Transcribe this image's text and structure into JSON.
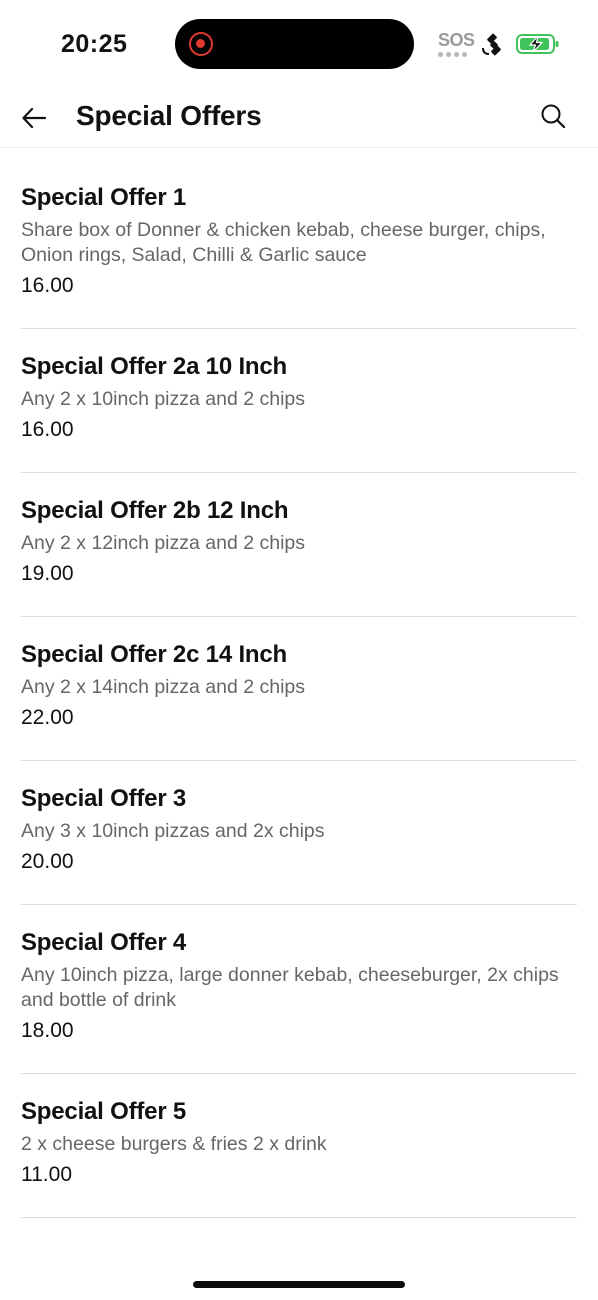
{
  "status_bar": {
    "time": "20:25",
    "sos_label": "SOS",
    "icons": [
      "recording-indicator",
      "satellite-icon",
      "battery-charging-icon"
    ],
    "battery_color": "#3fc35a",
    "recording_color": "#e23a2e"
  },
  "header": {
    "title": "Special Offers",
    "back_icon": "back-arrow-icon",
    "search_icon": "search-icon"
  },
  "offers": [
    {
      "name": "Special Offer 1",
      "description": "Share box of Donner & chicken kebab, cheese burger, chips, Onion rings, Salad, Chilli & Garlic sauce",
      "price": "16.00"
    },
    {
      "name": "Special Offer 2a 10 Inch",
      "description": "Any 2 x 10inch pizza and 2 chips",
      "price": "16.00"
    },
    {
      "name": "Special Offer 2b 12 Inch",
      "description": "Any 2 x 12inch pizza and 2 chips",
      "price": "19.00"
    },
    {
      "name": "Special Offer 2c 14 Inch",
      "description": "Any 2 x 14inch pizza and 2 chips",
      "price": "22.00"
    },
    {
      "name": "Special Offer 3",
      "description": "Any 3 x 10inch pizzas and 2x chips",
      "price": "20.00"
    },
    {
      "name": "Special Offer 4",
      "description": "Any 10inch pizza, large donner kebab, cheeseburger, 2x chips and bottle of drink",
      "price": "18.00"
    },
    {
      "name": "Special Offer 5",
      "description": "2 x cheese burgers & fries 2 x drink",
      "price": "11.00"
    }
  ]
}
